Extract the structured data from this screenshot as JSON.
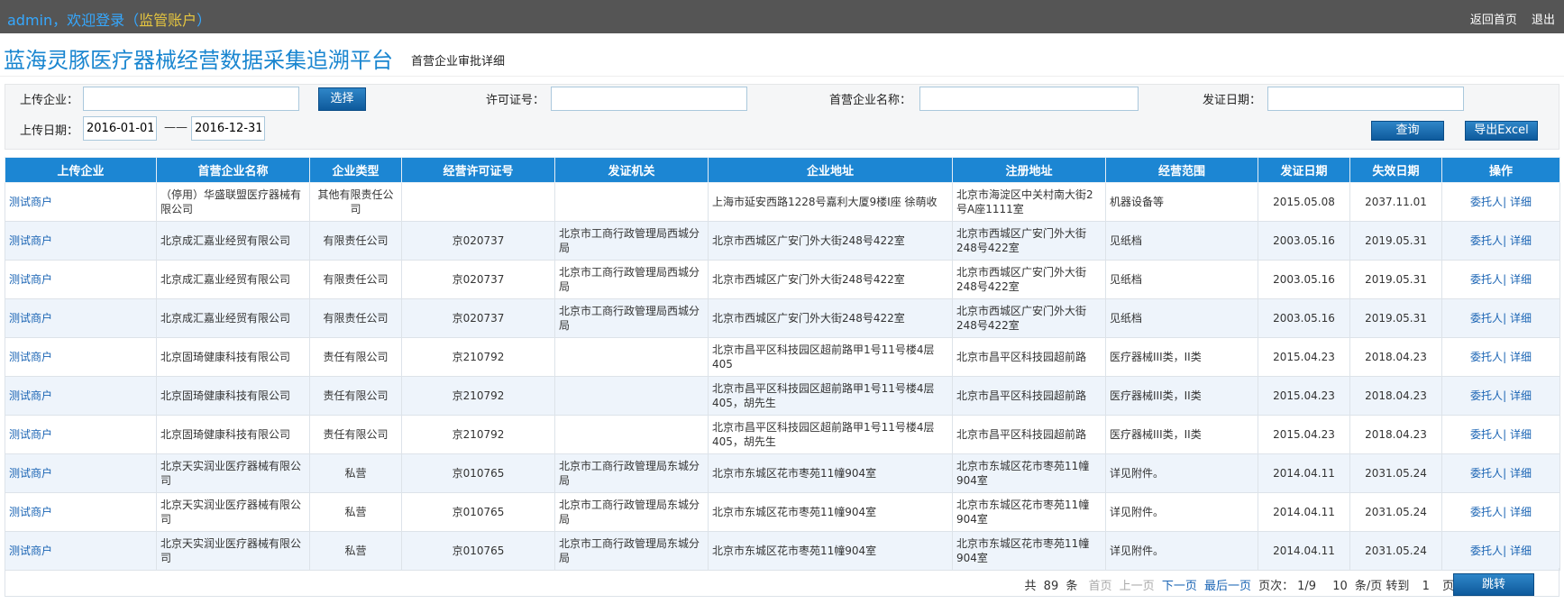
{
  "topbar": {
    "greeting_prefix": "admin，欢迎登录（",
    "account": "监管账户",
    "greeting_suffix": "）",
    "home_link": "返回首页",
    "logout_link": "退出"
  },
  "header": {
    "title": "蓝海灵豚医疗器械经营数据采集追溯平台",
    "subtitle": "首营企业审批详细"
  },
  "filter": {
    "upload_company_label": "上传企业：",
    "upload_company_value": "",
    "select_button": "选择",
    "license_label": "许可证号：",
    "license_value": "",
    "first_company_label": "首营企业名称：",
    "first_company_value": "",
    "issue_date_label": "发证日期：",
    "issue_date_value": "",
    "upload_date_label": "上传日期：",
    "date_from": "2016-01-01",
    "date_sep": "——",
    "date_to": "2016-12-31",
    "query_button": "查询",
    "export_button": "导出Excel"
  },
  "table": {
    "columns": [
      "上传企业",
      "首营企业名称",
      "企业类型",
      "经营许可证号",
      "发证机关",
      "企业地址",
      "注册地址",
      "经营范围",
      "发证日期",
      "失效日期",
      "操作"
    ],
    "action_entrust": "委托人",
    "action_sep": "|",
    "action_detail": "详细",
    "rows": [
      [
        "测试商户",
        "（停用）华盛联盟医疗器械有限公司",
        "其他有限责任公司",
        "",
        "",
        "上海市延安西路1228号嘉利大厦9楼I座 徐萌收",
        "北京市海淀区中关村南大街2号A座1111室",
        "机器设备等",
        "2015.05.08",
        "2037.11.01"
      ],
      [
        "测试商户",
        "北京成汇嘉业经贸有限公司",
        "有限责任公司",
        "京020737",
        "北京市工商行政管理局西城分局",
        "北京市西城区广安门外大街248号422室",
        "北京市西城区广安门外大街248号422室",
        "见纸档",
        "2003.05.16",
        "2019.05.31"
      ],
      [
        "测试商户",
        "北京成汇嘉业经贸有限公司",
        "有限责任公司",
        "京020737",
        "北京市工商行政管理局西城分局",
        "北京市西城区广安门外大街248号422室",
        "北京市西城区广安门外大街248号422室",
        "见纸档",
        "2003.05.16",
        "2019.05.31"
      ],
      [
        "测试商户",
        "北京成汇嘉业经贸有限公司",
        "有限责任公司",
        "京020737",
        "北京市工商行政管理局西城分局",
        "北京市西城区广安门外大街248号422室",
        "北京市西城区广安门外大街248号422室",
        "见纸档",
        "2003.05.16",
        "2019.05.31"
      ],
      [
        "测试商户",
        "北京固琦健康科技有限公司",
        "责任有限公司",
        "京210792",
        "",
        "北京市昌平区科技园区超前路甲1号11号楼4层405",
        "北京市昌平区科技园超前路",
        "医疗器械III类，II类",
        "2015.04.23",
        "2018.04.23"
      ],
      [
        "测试商户",
        "北京固琦健康科技有限公司",
        "责任有限公司",
        "京210792",
        "",
        "北京市昌平区科技园区超前路甲1号11号楼4层405，胡先生",
        "北京市昌平区科技园超前路",
        "医疗器械III类，II类",
        "2015.04.23",
        "2018.04.23"
      ],
      [
        "测试商户",
        "北京固琦健康科技有限公司",
        "责任有限公司",
        "京210792",
        "",
        "北京市昌平区科技园区超前路甲1号11号楼4层405，胡先生",
        "北京市昌平区科技园超前路",
        "医疗器械III类，II类",
        "2015.04.23",
        "2018.04.23"
      ],
      [
        "测试商户",
        "北京天实润业医疗器械有限公司",
        "私营",
        "京010765",
        "北京市工商行政管理局东城分局",
        "北京市东城区花市枣苑11幢904室",
        "北京市东城区花市枣苑11幢904室",
        "详见附件。",
        "2014.04.11",
        "2031.05.24"
      ],
      [
        "测试商户",
        "北京天实润业医疗器械有限公司",
        "私营",
        "京010765",
        "北京市工商行政管理局东城分局",
        "北京市东城区花市枣苑11幢904室",
        "北京市东城区花市枣苑11幢904室",
        "详见附件。",
        "2014.04.11",
        "2031.05.24"
      ],
      [
        "测试商户",
        "北京天实润业医疗器械有限公司",
        "私营",
        "京010765",
        "北京市工商行政管理局东城分局",
        "北京市东城区花市枣苑11幢904室",
        "北京市东城区花市枣苑11幢904室",
        "详见附件。",
        "2014.04.11",
        "2031.05.24"
      ]
    ]
  },
  "pager": {
    "total_prefix": "共",
    "total": "89",
    "total_suffix": "条",
    "first": "首页",
    "prev": "上一页",
    "next": "下一页",
    "last": "最后一页",
    "page_info_label": "页次：",
    "page_info": "1/9",
    "per_page": "10",
    "per_page_suffix": "条/页 转到",
    "goto_page": "1",
    "page_suffix": "页",
    "jump_button": "跳转"
  }
}
